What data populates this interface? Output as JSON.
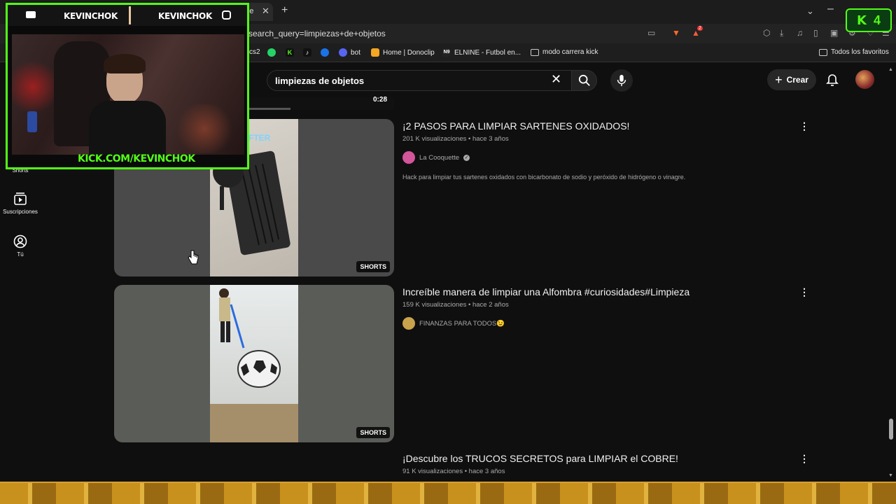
{
  "browser": {
    "tab_title": "ube",
    "url": "search_query=limpiezas+de+objetos",
    "extension_badge_count": "2",
    "bookmarks": [
      {
        "label": "cs2"
      },
      {
        "label": "bot"
      },
      {
        "label": "Home | Donoclip"
      },
      {
        "label": "ELNINE - Futbol en..."
      },
      {
        "label": "modo carrera kick"
      },
      {
        "label": "Todos los favoritos"
      }
    ]
  },
  "kick_badge": {
    "count": "4"
  },
  "youtube": {
    "search_query": "limpiezas de objetos",
    "create_label": "Crear",
    "prev_duration": "0:28",
    "sidebar": [
      {
        "label": "Shorts"
      },
      {
        "label": "Suscripciones"
      },
      {
        "label": "Tú"
      }
    ],
    "results": [
      {
        "title": "¡2 PASOS PARA LIMPIAR SARTENES OXIDADOS!",
        "meta": "201 K visualizaciones • hace 3 años",
        "channel": "La Cooquette",
        "verified": true,
        "description": "Hack para limpiar tus sartenes oxidados con bicarbonato de sodio y peróxido de hidrógeno o vinagre.",
        "badge": "SHORTS",
        "thumb_overlay_text": "FTER"
      },
      {
        "title": "Increíble manera de limpiar una Alfombra #curiosidades#Limpieza",
        "meta": "159 K visualizaciones • hace 2 años",
        "channel": "FINANZAS PARA TODOS😉",
        "badge": "SHORTS"
      },
      {
        "title": "¡Descubre los TRUCOS SECRETOS para LIMPIAR el COBRE!",
        "meta": "91 K visualizaciones • hace 3 años"
      }
    ]
  },
  "stream_overlay": {
    "name_left": "KEVINCHOK",
    "name_right": "KEVINCHOK",
    "link": "KICK.COM/KEVINCHOK"
  }
}
